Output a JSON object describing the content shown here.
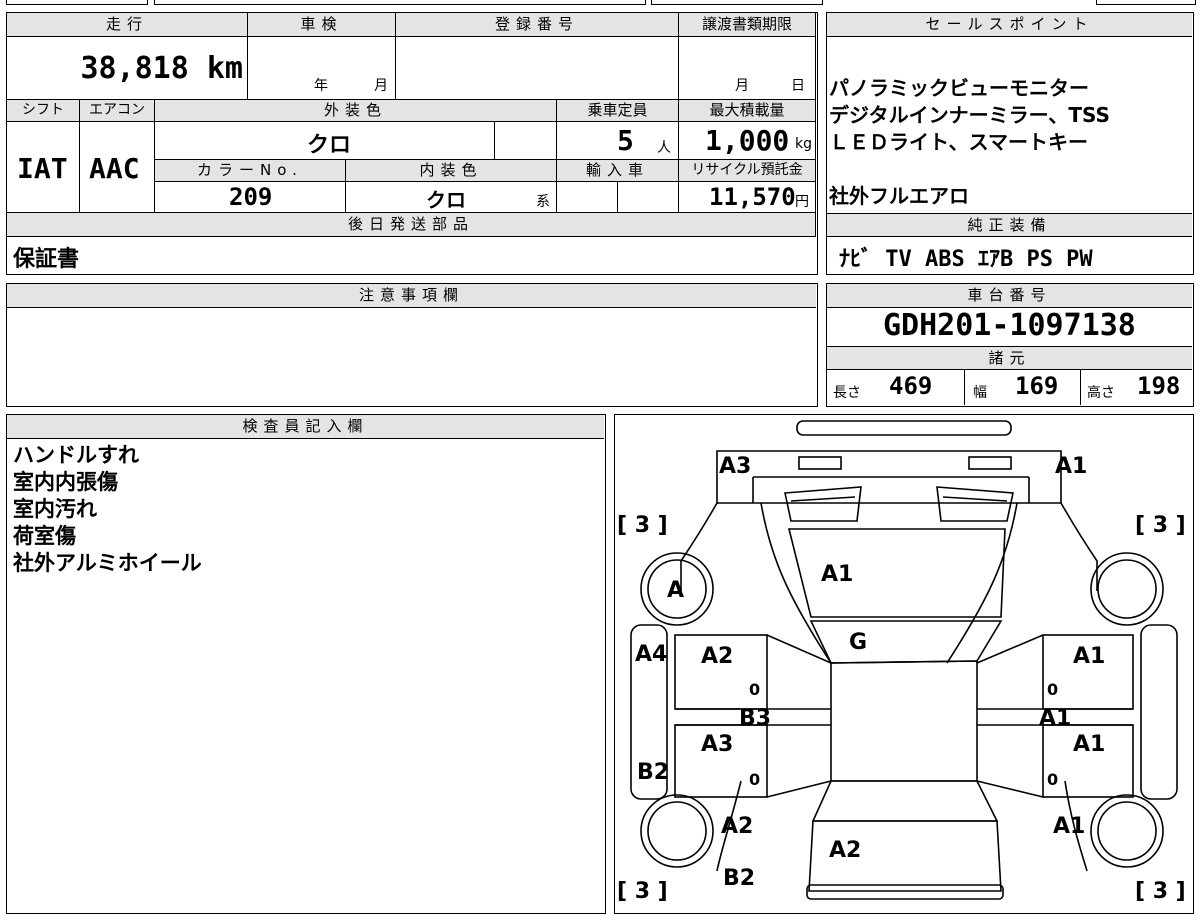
{
  "vehicle": {
    "mileage_label": "走行",
    "mileage_value": "38,818 km",
    "inspection_label": "車検",
    "inspection_year": "年",
    "inspection_month": "月",
    "registration_label": "登録番号",
    "transfer_deadline_label": "譲渡書類期限",
    "transfer_month": "月",
    "transfer_day": "日",
    "shift_label": "シフト",
    "shift_value": "IAT",
    "ac_label": "エアコン",
    "ac_value": "AAC",
    "exterior_label": "外装色",
    "exterior_value": "クロ",
    "capacity_label": "乗車定員",
    "capacity_value": "5",
    "capacity_unit": "人",
    "load_label": "最大積載量",
    "load_value": "1,000",
    "load_unit": "kg",
    "color_no_label": "カラーNo.",
    "color_no_value": "209",
    "interior_label": "内装色",
    "interior_value": "クロ",
    "interior_suffix": "系",
    "import_label": "輸入車",
    "recycle_label": "リサイクル預託金",
    "recycle_value": "11,570",
    "recycle_unit": "円",
    "later_parts_label": "後日発送部品",
    "later_parts_value": "保証書"
  },
  "sales_points": {
    "label": "セールスポイント",
    "lines": [
      "パノラミックビューモニター",
      "デジタルインナーミラー、TSS",
      "ＬＥＤライト、スマートキー",
      "",
      "社外フルエアロ"
    ]
  },
  "equipment": {
    "label": "純正装備",
    "value": "ﾅﾋﾞ TV ABS ｴｱB PS PW"
  },
  "notes": {
    "label": "注意事項欄"
  },
  "chassis": {
    "label": "車台番号",
    "value": "GDH201-1097138",
    "spec_label": "諸元",
    "length_label": "長さ",
    "length_value": "469",
    "width_label": "幅",
    "width_value": "169",
    "height_label": "高さ",
    "height_value": "198"
  },
  "inspector": {
    "label": "検査員記入欄",
    "lines": [
      "ハンドルすれ",
      "室内内張傷",
      "室内汚れ",
      "荷室傷",
      "社外アルミホイール"
    ]
  },
  "diagram": {
    "tire_left_top": "[ 3 ]",
    "tire_right_top": "[ 3 ]",
    "tire_left_bottom": "[ 3 ]",
    "tire_right_bottom": "[ 3 ]",
    "marks": {
      "front_left_corner": "A3",
      "front_right_corner": "A1",
      "hood": "A1",
      "left_front_wheel": "A",
      "windshield": "G",
      "left_front_pillar": "A4",
      "left_front_door": "A2",
      "left_front_door_small": "0",
      "left_rocker": "B3",
      "left_rear_door": "A3",
      "left_rear_door_small": "0",
      "left_rear_pillar": "B2",
      "left_rear_fender": "A2",
      "rear": "A2",
      "rear_bumper": "B2",
      "right_front_door": "A1",
      "right_front_door_small": "0",
      "right_rocker": "A1",
      "right_rear_door": "A1",
      "right_rear_door_small": "0",
      "right_rear_fender": "A1"
    }
  }
}
